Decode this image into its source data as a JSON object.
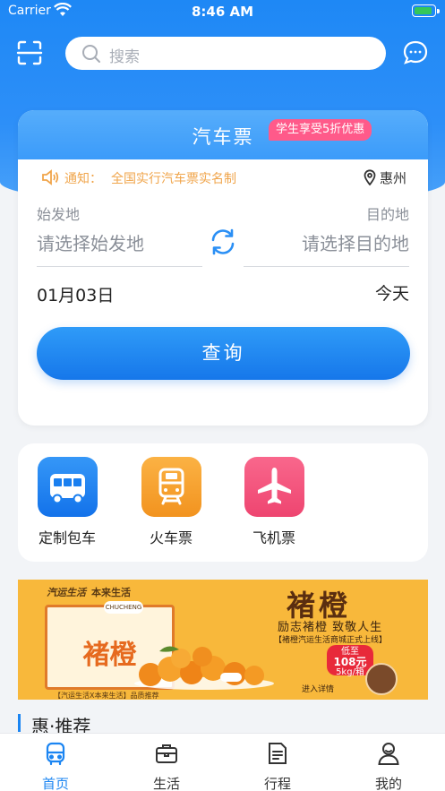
{
  "status_bar": {
    "carrier": "Carrier",
    "time": "8:46 AM"
  },
  "header": {
    "search_placeholder": "搜索"
  },
  "ticket": {
    "title": "汽车票",
    "promo": "学生享受5折优惠",
    "notice_label": "通知：",
    "notice_text": "全国实行汽车票实名制",
    "location": "惠州",
    "from_label": "始发地",
    "to_label": "目的地",
    "from_placeholder": "请选择始发地",
    "to_placeholder": "请选择目的地",
    "date": "01月03日",
    "day": "今天",
    "query_button": "查询"
  },
  "services": [
    {
      "label": "定制包车",
      "icon": "bus-icon",
      "color": "#1a7ff0"
    },
    {
      "label": "火车票",
      "icon": "train-icon",
      "color": "#f7a234"
    },
    {
      "label": "飞机票",
      "icon": "airplane-icon",
      "color": "#f4557a"
    }
  ],
  "banner": {
    "brand_left": "汽运生活",
    "brand_right": "本来生活",
    "badge": "CHUCHENG",
    "box_brand": "褚橙",
    "title": "褚橙",
    "slogan": "励志褚橙  致敬人生",
    "sub": "【褚橙汽运生活商城正式上线】",
    "price_prefix": "低至",
    "price": "108元",
    "price_unit": "5kg/箱",
    "cta": "进入详情",
    "footnote": "【汽运生活X本来生活】品质推荐"
  },
  "recommend": {
    "title": "惠·推荐"
  },
  "tabbar": [
    {
      "label": "首页",
      "icon": "bus-front-icon",
      "active": true
    },
    {
      "label": "生活",
      "icon": "briefcase-icon",
      "active": false
    },
    {
      "label": "行程",
      "icon": "document-icon",
      "active": false
    },
    {
      "label": "我的",
      "icon": "user-icon",
      "active": false
    }
  ],
  "colors": {
    "primary": "#1b85f2",
    "notice": "#f0a54b",
    "promo": "#ff5a8a"
  }
}
